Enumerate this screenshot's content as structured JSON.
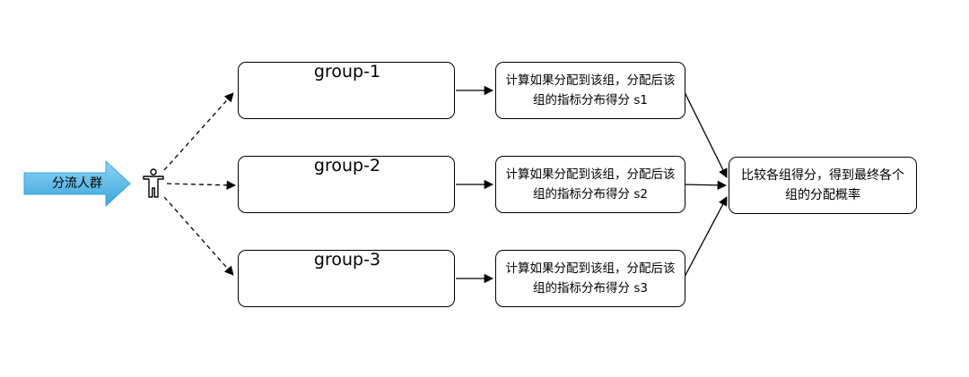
{
  "entry": {
    "label": "分流人群",
    "arrow_color": "#5cb8e6"
  },
  "groups": [
    {
      "title": "group-1",
      "score_text": "计算如果分配到该组，分配后该组的指标分布得分 s1"
    },
    {
      "title": "group-2",
      "score_text": "计算如果分配到该组，分配后该组的指标分布得分 s2"
    },
    {
      "title": "group-3",
      "score_text": "计算如果分配到该组，分配后该组的指标分布得分 s3"
    }
  ],
  "result": {
    "text": "比较各组得分，得到最终各个组的分配概率"
  },
  "icons": {
    "member": "person-filled-icon",
    "candidate": "person-outline-icon"
  },
  "colors": {
    "stroke": "#000000",
    "entry_arrow": "#5cb8e6"
  }
}
